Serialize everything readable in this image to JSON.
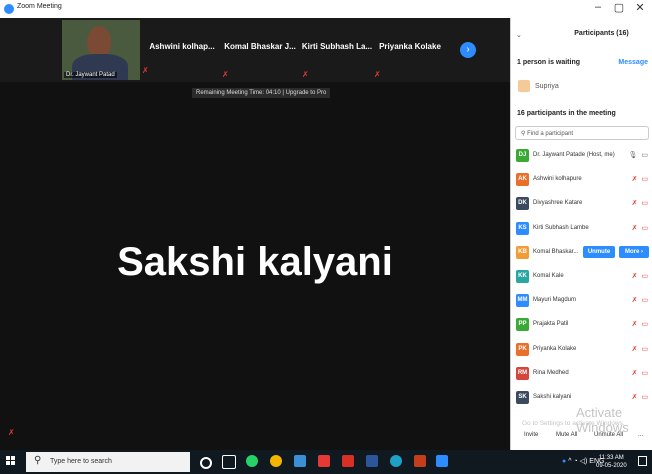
{
  "window": {
    "title": "Zoom Meeting",
    "controls": [
      "–",
      "▢",
      "✕"
    ]
  },
  "strip": {
    "video_name": "Dr. Jaywant Patad",
    "thumbs": [
      "Ashwini kolhap...",
      "Komal Bhaskar J...",
      "Kirti Subhash La...",
      "Priyanka Kolake"
    ]
  },
  "banner": "Remaining Meeting Time: 04:10 | Upgrade to Pro",
  "speaker_name": "Sakshi kalyani",
  "panel": {
    "title": "Participants (16)",
    "waiting_heading": "1 person is waiting",
    "message_label": "Message",
    "waiting_name": "Supriya",
    "count_heading": "16 participants in the meeting",
    "search_placeholder": "Find a participant",
    "participants": [
      {
        "initials": "DJ",
        "name": "Dr. Jaywant Patade (Host, me)",
        "color": "#3aaa35",
        "icons": "🎙 ▭"
      },
      {
        "initials": "AK",
        "name": "Ashwini kolhapure",
        "color": "#e8702a",
        "icons": "✗ ▭"
      },
      {
        "initials": "DK",
        "name": "Divyashree Katare",
        "color": "#3c4a5e",
        "icons": "✗ ▭"
      },
      {
        "initials": "KS",
        "name": "Kirti Subhash Lambe",
        "color": "#2d8cff",
        "icons": "✗ ▭"
      },
      {
        "initials": "KB",
        "name": "Komal Bhaskar...",
        "color": "#f29c38",
        "icons": ""
      },
      {
        "initials": "KK",
        "name": "Komal Kale",
        "color": "#2aa6a0",
        "icons": "✗ ▭"
      },
      {
        "initials": "MM",
        "name": "Mayuri Magdum",
        "color": "#2d8cff",
        "icons": "✗ ▭"
      },
      {
        "initials": "PP",
        "name": "Prajakta Patil",
        "color": "#3aaa35",
        "icons": "✗ ▭"
      },
      {
        "initials": "PK",
        "name": "Priyanka Kolake",
        "color": "#e8702a",
        "icons": "✗ ▭"
      },
      {
        "initials": "RM",
        "name": "Rina Medhed",
        "color": "#d6453b",
        "icons": "✗ ▭"
      },
      {
        "initials": "SK",
        "name": "Sakshi kalyani",
        "color": "#3c4a5e",
        "icons": "✗ ▭"
      }
    ],
    "unmute_label": "Unmute",
    "more_label": "More ›",
    "watermark_title": "Activate Windows",
    "watermark_sub": "Go to Settings to activate Windows.",
    "bottom": {
      "invite": "Invite",
      "mute_all": "Mute All",
      "unmute_all": "Unmute All",
      "more": "..."
    }
  },
  "taskbar": {
    "search_placeholder": "Type here to search",
    "time": "11:33 AM",
    "date": "09-05-2020",
    "lang": "ENG"
  },
  "colors": {
    "zoom_blue": "#2d8cff",
    "mute_red": "#e53935"
  }
}
